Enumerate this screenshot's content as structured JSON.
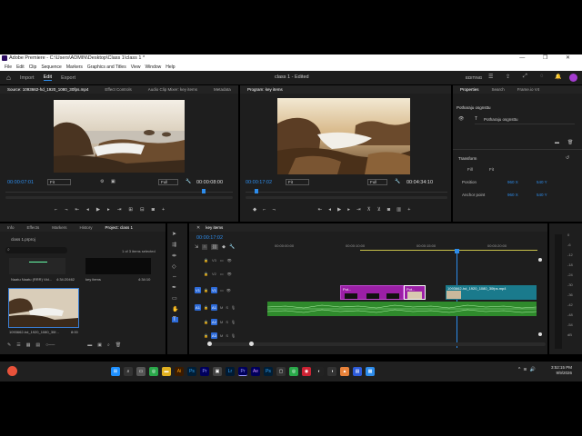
{
  "window": {
    "title": "Adobe Premiere - C:\\Users\\ADMIN\\Desktop\\Class 1\\class 1 *",
    "controls": "— ❐ ✕"
  },
  "menu": [
    "File",
    "Edit",
    "Clip",
    "Sequence",
    "Markers",
    "Graphics and Titles",
    "View",
    "Window",
    "Help"
  ],
  "appbar": {
    "nav": [
      "Import",
      "Edit",
      "Export"
    ],
    "active": "Edit",
    "center_title": "class 1 - Edited",
    "workspace": "EDITING"
  },
  "source_panel": {
    "tabs": [
      "Source: 1093662-hd_1920_1080_30fps.mp4",
      "Effect Controls",
      "Audio Clip Mixer: key items",
      "Metadata"
    ],
    "timecode_left": "00:00:07:01",
    "fit": "Fit",
    "quality": "Full",
    "timecode_right": "00:00:08:00"
  },
  "program_panel": {
    "tab": "Program: key items",
    "timecode_left": "00:00:17:02",
    "fit": "Fit",
    "quality": "Full",
    "timecode_right": "00:04:34:10"
  },
  "properties_panel": {
    "tabs": [
      "Properties",
      "Search",
      "Frame.io V4"
    ],
    "item1": "Potharaju osgnsttu",
    "item2": "Potharaju osgnsttu",
    "section": "Transform",
    "fill": "Fill",
    "fit": "Fit",
    "position_label": "Position",
    "position_x": "960 X",
    "position_y": "540 Y",
    "anchor_label": "Anchor point",
    "anchor_x": "960 X",
    "anchor_y": "540 Y"
  },
  "project_panel": {
    "tabs": [
      "Info",
      "Effects",
      "Markers",
      "History",
      "Project: class 1"
    ],
    "file": "class 1.prproj",
    "selection": "1 of 3 items selected",
    "bin1_name": "Naatu Naatu (RRR) Vid...",
    "bin1_dur": "4:34:20462",
    "bin2_name": "key items",
    "bin2_dur": "4:34:10",
    "clip_name": "1093662-hd_1920_1080_30f...",
    "clip_dur": "8:00"
  },
  "timeline": {
    "tab": "key items",
    "timecode": "00:00:17:02",
    "ruler": [
      "00:00:00:00",
      "00:00:10:00",
      "00:00:15:00",
      "00:00:20:00"
    ],
    "tracks_video": [
      "V3",
      "V2",
      "V1"
    ],
    "tracks_audio": [
      "A1",
      "A2",
      "A3"
    ],
    "clip_teal": "1093662-hd_1920_1080_30fps.mp4",
    "clip_pu1": "Pot...",
    "clip_pu2": "Pot..."
  },
  "meters": [
    "0",
    "-6",
    "-12",
    "-18",
    "-24",
    "-30",
    "-36",
    "-42",
    "-48",
    "-54",
    "dB"
  ],
  "taskbar": {
    "time": "3:52:15 PM",
    "date": "9/9/2026"
  },
  "colors": {
    "accent": "#2d8ceb",
    "clip_purple": "#9b1fa6",
    "clip_teal": "#1a7a8c",
    "audio_green": "#2f8a2c"
  }
}
